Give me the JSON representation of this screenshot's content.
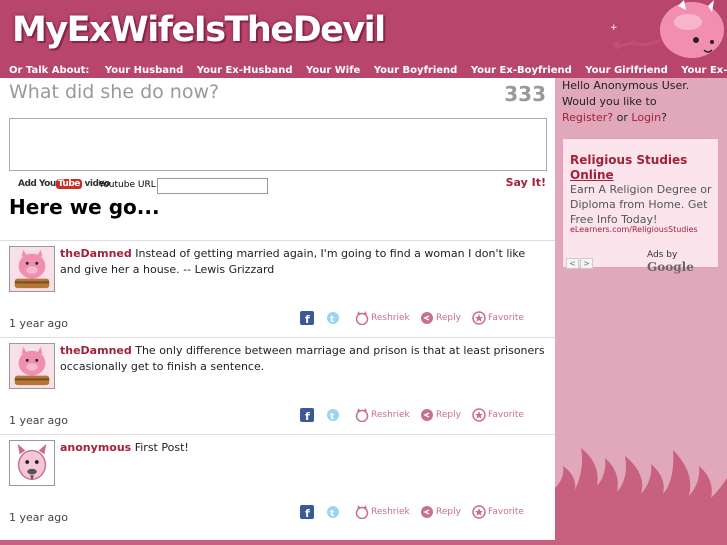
{
  "site": {
    "logo": "MyExWifeIsTheDevil"
  },
  "nav": {
    "lead": "Or Talk About:",
    "items": [
      "Your Husband",
      "Your Ex-Husband",
      "Your Wife",
      "Your Boyfriend",
      "Your Ex-Boyfriend",
      "Your Girlfriend",
      "Your Ex-"
    ]
  },
  "composer": {
    "prompt": "What did she do now?",
    "counter": "333",
    "textarea_value": "",
    "youtube_badge_prefix": "Add You",
    "youtube_badge_tube": "Tube",
    "youtube_badge_suffix": " video",
    "youtube_label": "Youtube URL",
    "youtube_value": "",
    "submit": "Say It!"
  },
  "feed": {
    "title": "Here we go...",
    "items": [
      {
        "user": "theDamned",
        "avatar": "pig-avatar",
        "text": "Instead of getting married again, I'm going to find a woman I don't like and give her a house. -- Lewis Grizzard",
        "age": "1 year ago"
      },
      {
        "user": "theDamned",
        "avatar": "pig-avatar",
        "text": "The only difference between marriage and prison is that at least prisoners occasionally get to finish a sentence.",
        "age": "1 year ago"
      },
      {
        "user": "anonymous",
        "avatar": "devil-avatar",
        "text": "First Post!",
        "age": "1 year ago"
      }
    ],
    "actions": {
      "reshriek": "Reshriek",
      "reply": "Reply",
      "favorite": "Favorite"
    }
  },
  "sidebar": {
    "hello": "Hello Anonymous User.",
    "prompt": "Would you like to",
    "register": "Register?",
    "or": "or",
    "login": "Login",
    "qmark": "?"
  },
  "ad": {
    "title_line1": "Religious Studies",
    "title_line2": "Online",
    "body": "Earn A Religion Degree or Diploma from Home. Get Free Info Today!",
    "url": "eLearners.com/ReligiousStudies",
    "prev": "<",
    "next": ">",
    "ads_by": "Ads by",
    "google": "Google"
  },
  "colors": {
    "brand": "#b8466c",
    "accent": "#a2223a",
    "sidebar": "#e1a7bb"
  }
}
